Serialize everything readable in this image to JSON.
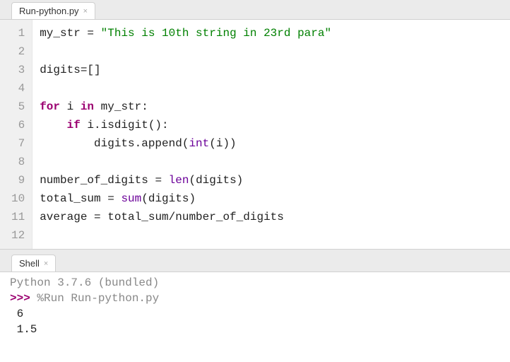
{
  "tabs": {
    "editor": {
      "label": "Run-python.py"
    },
    "shell": {
      "label": "Shell"
    }
  },
  "code": {
    "lines": [
      "1",
      "2",
      "3",
      "4",
      "5",
      "6",
      "7",
      "8",
      "9",
      "10",
      "11",
      "12"
    ],
    "l1_a": "my_str ",
    "l1_eq": "=",
    "l1_str": " \"This is 10th string in 23rd para\"",
    "l3_a": "digits",
    "l3_eq": "=",
    "l3_b": "[]",
    "l5_for": "for",
    "l5_i": " i ",
    "l5_in": "in",
    "l5_rest": " my_str:",
    "l6_pad": "    ",
    "l6_if": "if",
    "l6_rest": " i.isdigit():",
    "l7_pad": "        digits.append(",
    "l7_int": "int",
    "l7_rest": "(i))",
    "l9_a": "number_of_digits ",
    "l9_eq": "=",
    "l9_sp": " ",
    "l9_len": "len",
    "l9_rest": "(digits)",
    "l10_a": "total_sum ",
    "l10_eq": "=",
    "l10_sp": " ",
    "l10_sum": "sum",
    "l10_rest": "(digits)",
    "l11_a": "average ",
    "l11_eq": "=",
    "l11_rest": " total_sum/number_of_digits"
  },
  "shell": {
    "greeting": "Python 3.7.6 (bundled)",
    "prompt": ">>> ",
    "cmd": "%Run Run-python.py",
    "out1": " 6",
    "out2": " 1.5"
  }
}
